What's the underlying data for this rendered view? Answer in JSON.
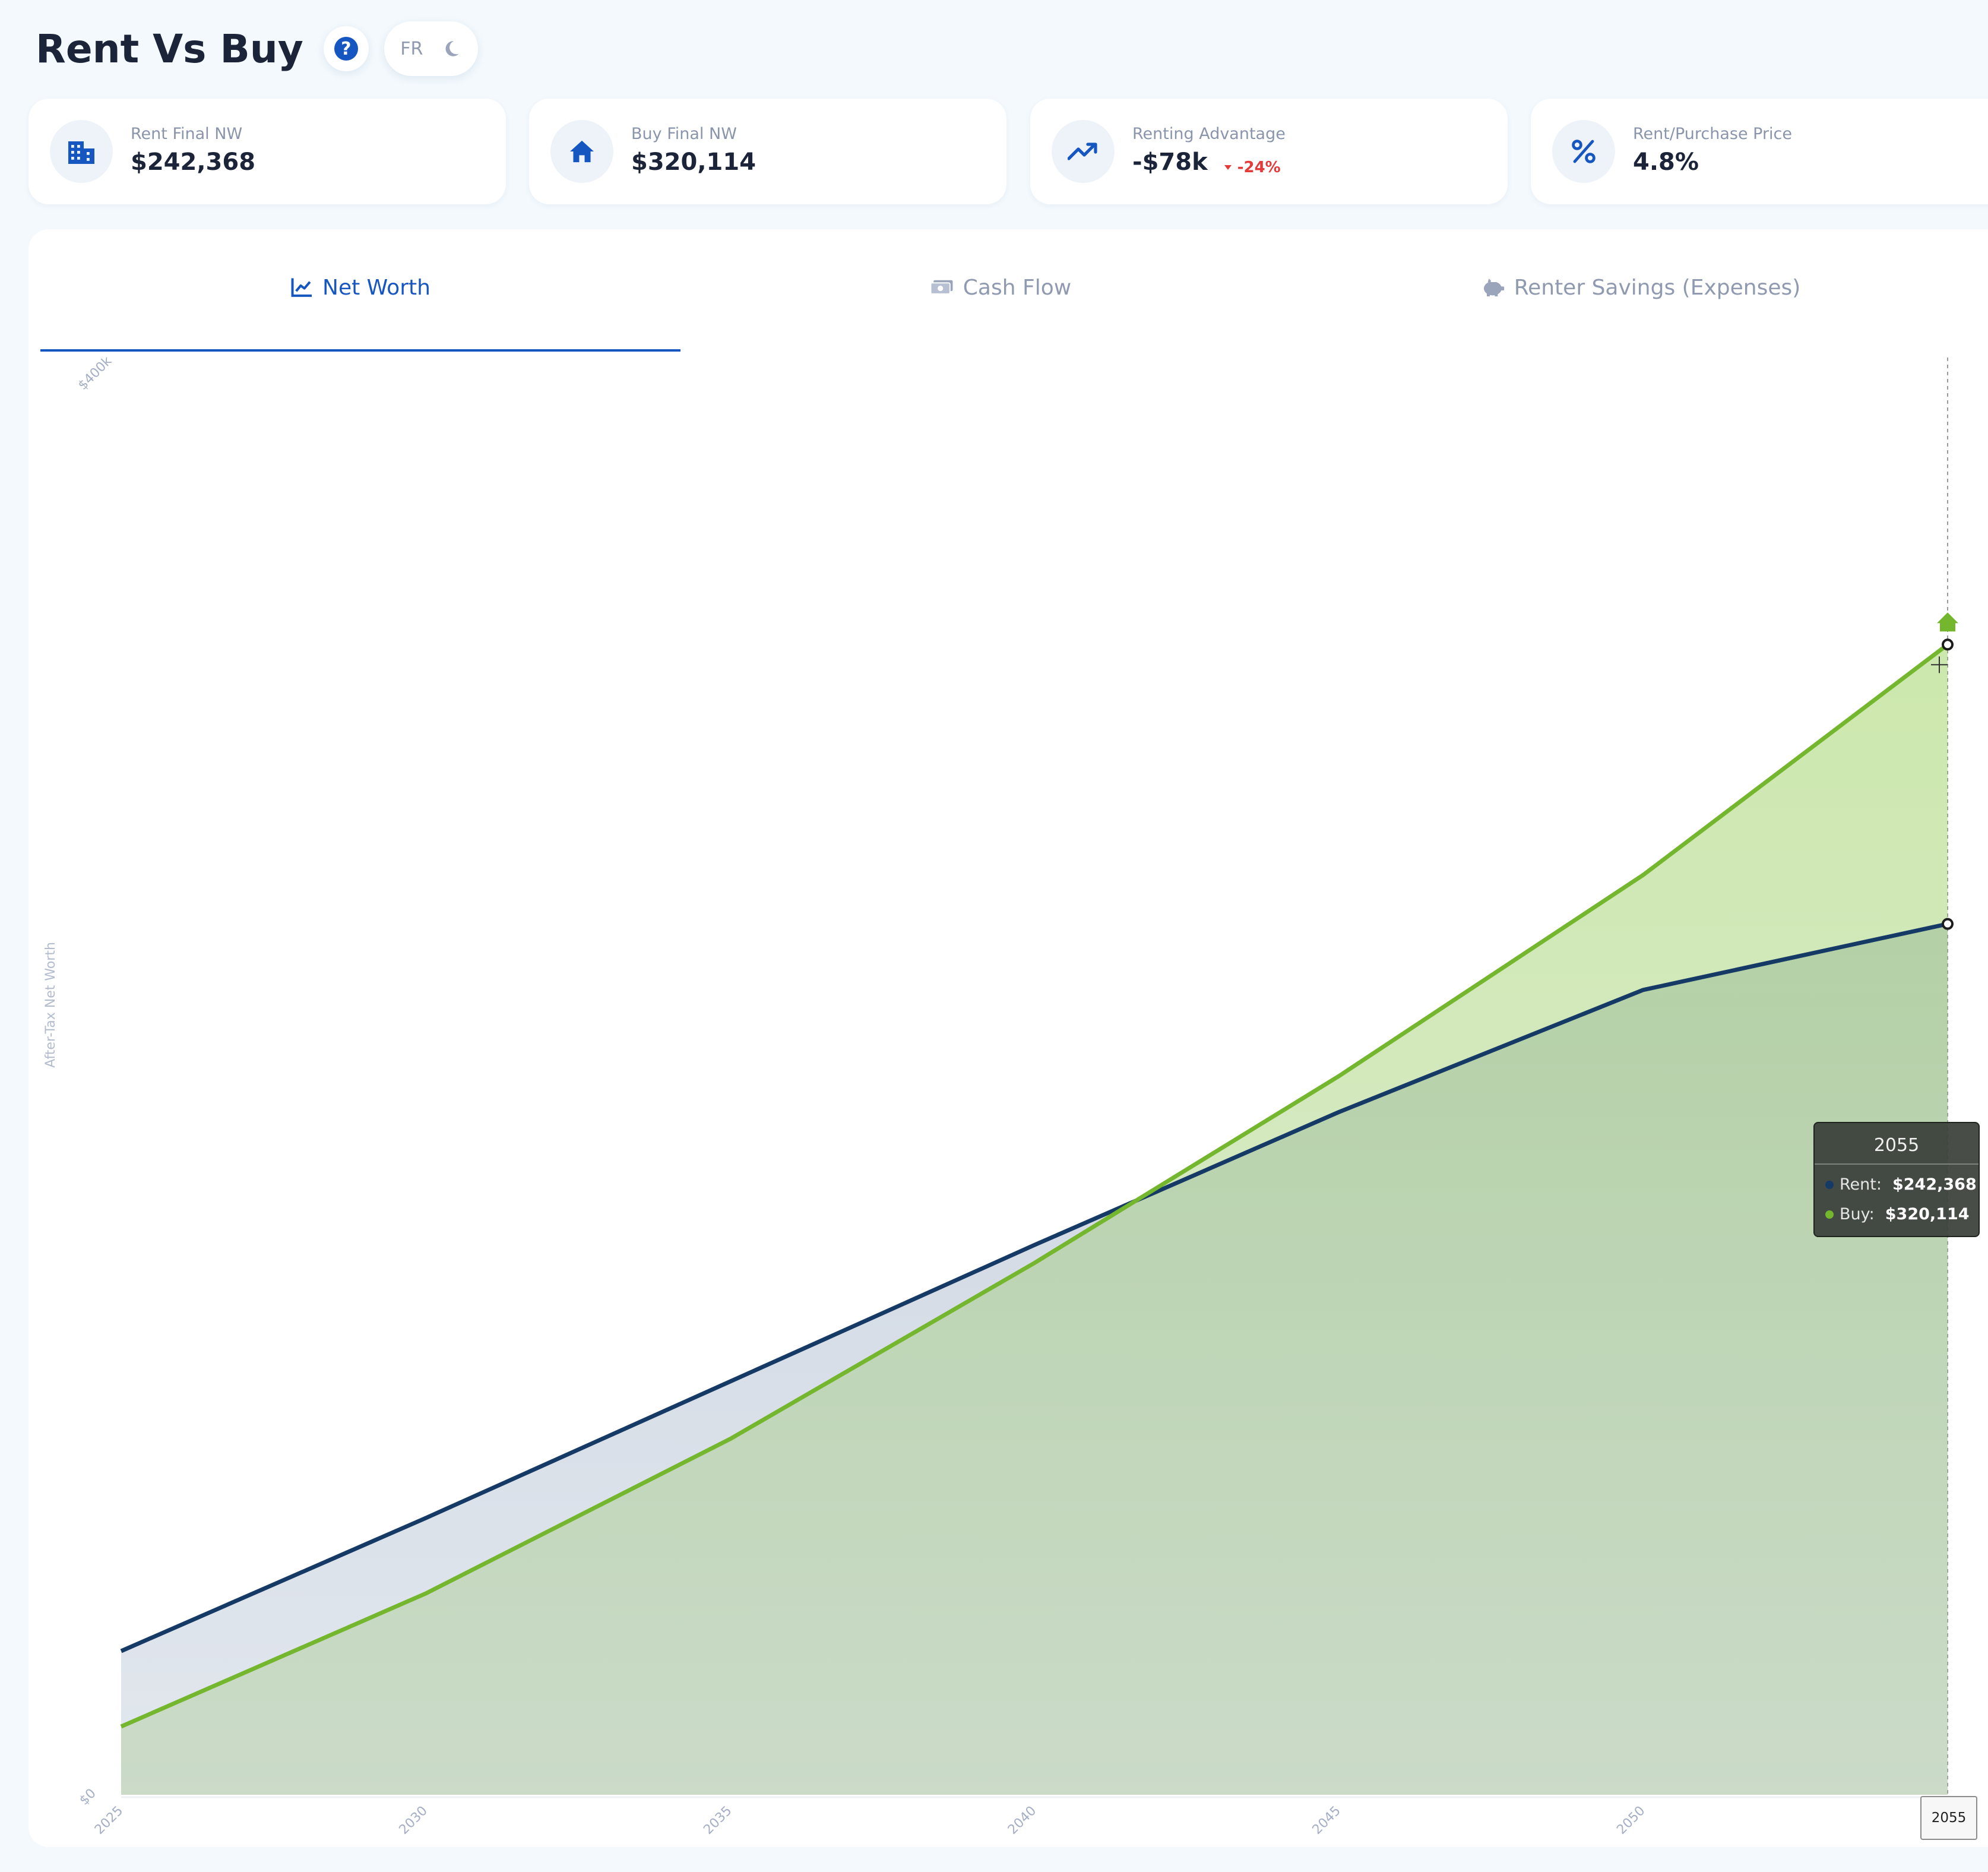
{
  "header": {
    "title": "Rent Vs Buy",
    "help_icon": "question-circle-icon",
    "lang": "FR",
    "theme_icon": "moon-icon"
  },
  "cards": [
    {
      "label": "Rent Final NW",
      "value": "$242,368",
      "icon": "building-icon"
    },
    {
      "label": "Buy Final NW",
      "value": "$320,114",
      "icon": "home-icon"
    },
    {
      "label": "Renting Advantage",
      "value": "-$78k",
      "delta": "-24%",
      "icon": "trending-up-icon"
    },
    {
      "label": "Rent/Purchase Price",
      "value": "4.8%",
      "icon": "percent-icon"
    }
  ],
  "tabs": [
    {
      "label": "Net Worth",
      "icon": "line-chart-icon",
      "active": true
    },
    {
      "label": "Cash Flow",
      "icon": "money-icon",
      "active": false
    },
    {
      "label": "Renter Savings (Expenses)",
      "icon": "piggy-bank-icon",
      "active": false
    }
  ],
  "colors": {
    "accent": "#1556c0",
    "rent": "#163a66",
    "buy": "#74b72e",
    "negative": "#e53a3a"
  },
  "chart_data": {
    "type": "area",
    "ylabel": "After-Tax Net Worth",
    "ylim": [
      0,
      400000
    ],
    "y_tick_labels": [
      "$0",
      "$400k"
    ],
    "x_tick_labels": [
      "2025",
      "2030",
      "2035",
      "2040",
      "2045",
      "2050"
    ],
    "xlim": [
      2025,
      2055
    ],
    "grid": false,
    "series": [
      {
        "name": "Rent",
        "x": [
          2025,
          2030,
          2035,
          2040,
          2045,
          2050,
          2055
        ],
        "y": [
          40000,
          77000,
          115000,
          153000,
          190000,
          224000,
          242368
        ]
      },
      {
        "name": "Buy",
        "x": [
          2025,
          2030,
          2035,
          2040,
          2045,
          2050,
          2055
        ],
        "y": [
          19000,
          56000,
          99000,
          148000,
          200000,
          256000,
          320114
        ]
      }
    ],
    "tooltip": {
      "title": "2055",
      "rows": [
        {
          "label": "Rent:",
          "value": "$242,368"
        },
        {
          "label": "Buy:",
          "value": "$320,114"
        }
      ]
    },
    "crosshair_x_label": "2055"
  }
}
